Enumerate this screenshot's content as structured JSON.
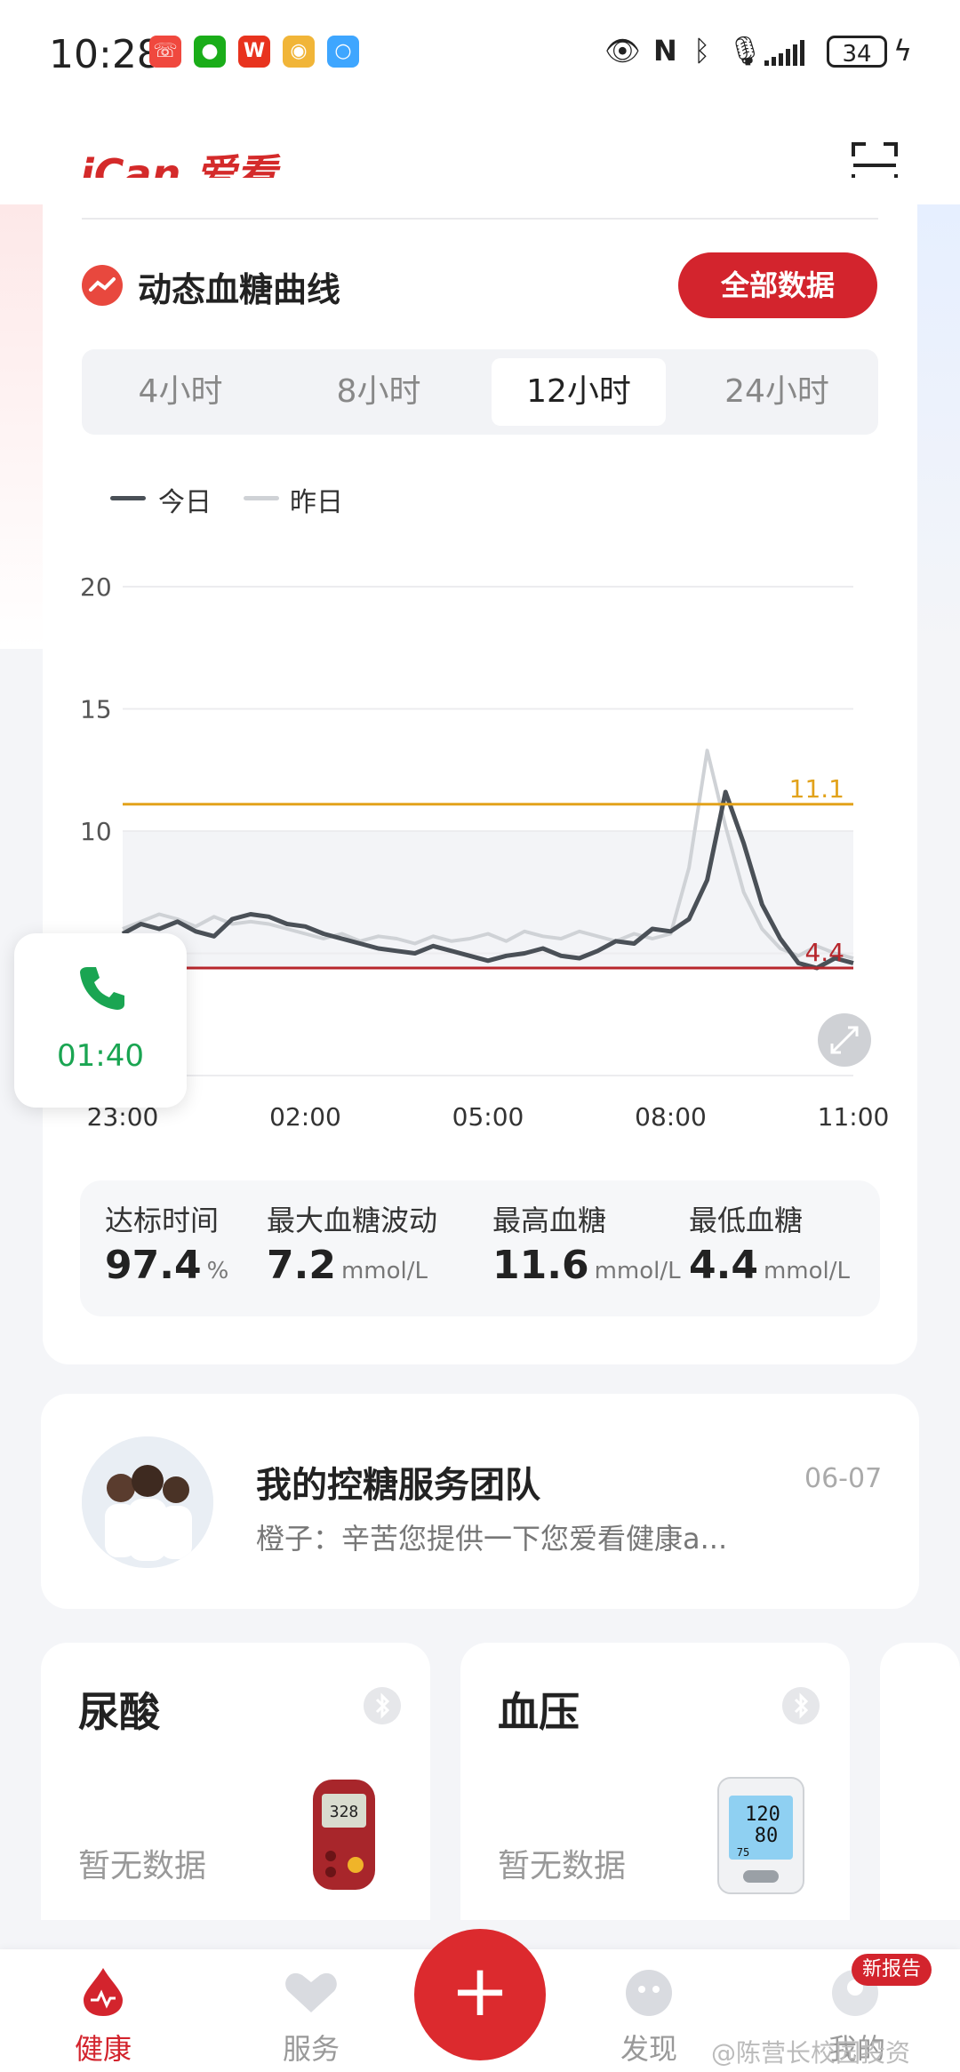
{
  "status_bar": {
    "time": "10:28",
    "battery": "34",
    "apps": [
      {
        "icon": "phone-missed-icon",
        "color": "#f0483e",
        "glyph": "☏"
      },
      {
        "icon": "wechat-icon",
        "color": "#1aad19",
        "glyph": "●"
      },
      {
        "icon": "wps-icon",
        "color": "#e8331e",
        "glyph": "W"
      },
      {
        "icon": "weibo-icon",
        "color": "#f1b538",
        "glyph": "◉"
      },
      {
        "icon": "chat-bubble-icon",
        "color": "#3ea6ff",
        "glyph": "○"
      }
    ]
  },
  "header": {
    "logo_text": "iCan 爱看"
  },
  "cgm": {
    "title": "动态血糖曲线",
    "all_data_button": "全部数据",
    "tabs": [
      "4小时",
      "8小时",
      "12小时",
      "24小时"
    ],
    "active_tab": "12小时",
    "legend": {
      "today": "今日",
      "yesterday": "昨日"
    }
  },
  "chart_data": {
    "type": "line",
    "x_ticks": [
      "23:00",
      "02:00",
      "05:00",
      "08:00",
      "11:00"
    ],
    "y_ticks": [
      20,
      15,
      10
    ],
    "ylim": [
      0,
      20
    ],
    "target_range": [
      4.4,
      10
    ],
    "reference_lines": [
      {
        "value": 11.1,
        "label": "11.1",
        "color": "#e2a21b"
      },
      {
        "value": 4.4,
        "label": "4.4",
        "color": "#b7262c"
      }
    ],
    "series": [
      {
        "name": "今日",
        "color": "#4a5057",
        "x": [
          0,
          0.3,
          0.6,
          0.9,
          1.2,
          1.5,
          1.8,
          2.1,
          2.4,
          2.7,
          3.0,
          3.3,
          3.6,
          3.9,
          4.2,
          4.5,
          4.8,
          5.1,
          5.4,
          5.7,
          6.0,
          6.3,
          6.6,
          6.9,
          7.2,
          7.5,
          7.8,
          8.1,
          8.4,
          8.7,
          9.0,
          9.3,
          9.6,
          9.9,
          10.2,
          10.5,
          10.8,
          11.1,
          11.4,
          11.7,
          12.0
        ],
        "values": [
          5.8,
          6.2,
          6.0,
          6.3,
          5.9,
          5.7,
          6.4,
          6.6,
          6.5,
          6.2,
          6.1,
          5.8,
          5.6,
          5.4,
          5.2,
          5.1,
          5.0,
          5.3,
          5.1,
          4.9,
          4.7,
          4.9,
          5.0,
          5.2,
          4.9,
          4.8,
          5.1,
          5.5,
          5.4,
          6.0,
          5.9,
          6.4,
          8.0,
          11.6,
          9.5,
          7.0,
          5.6,
          4.6,
          4.4,
          4.8,
          4.6
        ]
      },
      {
        "name": "昨日",
        "color": "#cfd2d6",
        "x": [
          0,
          0.3,
          0.6,
          0.9,
          1.2,
          1.5,
          1.8,
          2.1,
          2.4,
          2.7,
          3.0,
          3.3,
          3.6,
          3.9,
          4.2,
          4.5,
          4.8,
          5.1,
          5.4,
          5.7,
          6.0,
          6.3,
          6.6,
          6.9,
          7.2,
          7.5,
          7.8,
          8.1,
          8.4,
          8.7,
          9.0,
          9.3,
          9.6,
          9.9,
          10.2,
          10.5,
          10.8,
          11.1,
          11.4,
          11.7,
          12.0
        ],
        "values": [
          6.0,
          6.3,
          6.6,
          6.4,
          6.1,
          6.5,
          6.2,
          6.3,
          6.2,
          6.0,
          5.8,
          5.6,
          5.8,
          5.5,
          5.7,
          5.6,
          5.4,
          5.7,
          5.5,
          5.6,
          5.8,
          5.5,
          5.9,
          5.7,
          5.6,
          5.9,
          5.7,
          5.5,
          5.8,
          5.6,
          5.8,
          8.5,
          13.3,
          10.2,
          7.5,
          6.0,
          5.2,
          4.9,
          5.3,
          5.0,
          4.8
        ]
      }
    ]
  },
  "call": {
    "time": "01:40"
  },
  "stats": [
    {
      "label": "达标时间",
      "value": "97.4",
      "unit": "%"
    },
    {
      "label": "最大血糖波动",
      "value": "7.2",
      "unit": "mmol/L"
    },
    {
      "label": "最高血糖",
      "value": "11.6",
      "unit": "mmol/L"
    },
    {
      "label": "最低血糖",
      "value": "4.4",
      "unit": "mmol/L"
    }
  ],
  "team": {
    "title": "我的控糖服务团队",
    "date": "06-07",
    "message": "橙子：辛苦您提供一下您爱看健康a..."
  },
  "devices": [
    {
      "title": "尿酸",
      "empty": "暂无数据"
    },
    {
      "title": "血压",
      "empty": "暂无数据"
    }
  ],
  "nav": {
    "items": [
      "健康",
      "服务",
      "发现",
      "我的"
    ],
    "badge": "新报告"
  },
  "watermark": "@陈营长校园投资"
}
